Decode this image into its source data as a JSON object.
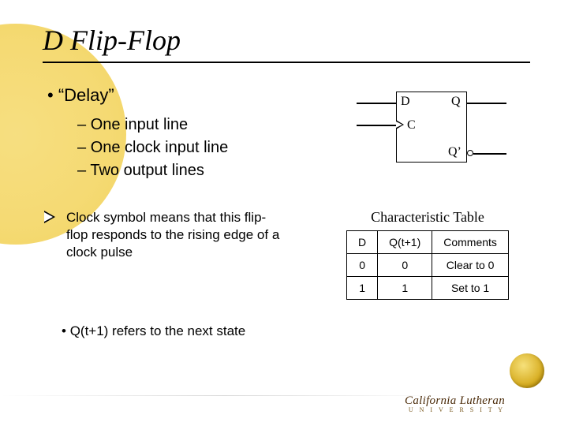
{
  "title": "D Flip-Flop",
  "bullet_main": "“Delay”",
  "subs": {
    "a": "One input line",
    "b": "One clock input line",
    "c": "Two output lines"
  },
  "diagram": {
    "D": "D",
    "C": "C",
    "Q": "Q",
    "Qp": "Q’"
  },
  "clock_note": "Clock symbol means that this flip-flop responds to the rising edge of a clock pulse",
  "table": {
    "caption": "Characteristic Table",
    "headers": {
      "c0": "D",
      "c1": "Q(t+1)",
      "c2": "Comments"
    },
    "r0": {
      "c0": "0",
      "c1": "0",
      "c2": "Clear to 0"
    },
    "r1": {
      "c0": "1",
      "c1": "1",
      "c2": "Set to 1"
    }
  },
  "chart_data": {
    "type": "table",
    "title": "Characteristic Table",
    "columns": [
      "D",
      "Q(t+1)",
      "Comments"
    ],
    "rows": [
      [
        "0",
        "0",
        "Clear to 0"
      ],
      [
        "1",
        "1",
        "Set to 1"
      ]
    ]
  },
  "next_state_note": "Q(t+1) refers to the next state",
  "logo": {
    "brand": "California Lutheran",
    "sub": "U N I V E R S I T Y"
  }
}
